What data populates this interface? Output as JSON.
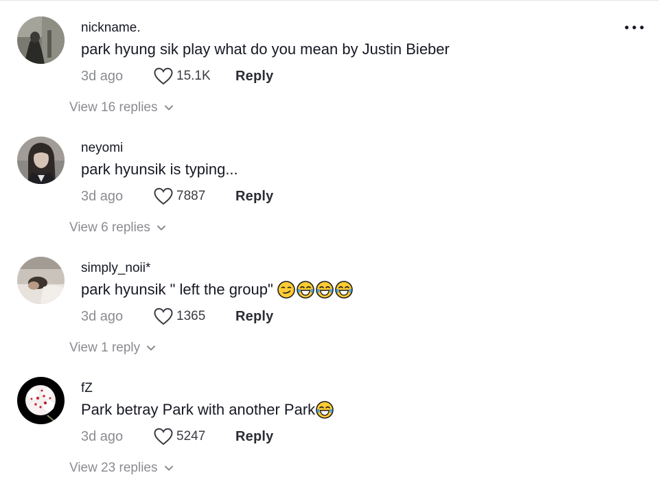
{
  "more_menu": {
    "icon": "more-horizontal-icon"
  },
  "colors": {
    "text_primary": "#161823",
    "text_secondary": "#8a8b91",
    "reply": "#2b2c33"
  },
  "comments": [
    {
      "username": "nickname.",
      "text": "park hyung sik play what do you mean by Justin Bieber",
      "emojis": [],
      "timestamp": "3d ago",
      "likes": "15.1K",
      "reply_label": "Reply",
      "view_replies": "View 16 replies",
      "avatar": "avatar-dark-figure"
    },
    {
      "username": "neyomi",
      "text": "park hyunsik is typing...",
      "emojis": [],
      "timestamp": "3d ago",
      "likes": "7887",
      "reply_label": "Reply",
      "view_replies": "View 6 replies",
      "avatar": "avatar-girl-portrait"
    },
    {
      "username": "simply_noii*",
      "text": "park hyunsik \" left the group\"",
      "emojis": [
        "smirking-face",
        "face-with-tears-of-joy",
        "face-with-tears-of-joy",
        "face-with-tears-of-joy"
      ],
      "timestamp": "3d ago",
      "likes": "1365",
      "reply_label": "Reply",
      "view_replies": "View 1 reply",
      "avatar": "avatar-sleeping-person"
    },
    {
      "username": "fZ",
      "text": "Park betray Park with another Park",
      "emojis": [
        "face-with-tears-of-joy"
      ],
      "timestamp": "3d ago",
      "likes": "5247",
      "reply_label": "Reply",
      "view_replies": "View 23 replies",
      "avatar": "avatar-flower"
    }
  ]
}
